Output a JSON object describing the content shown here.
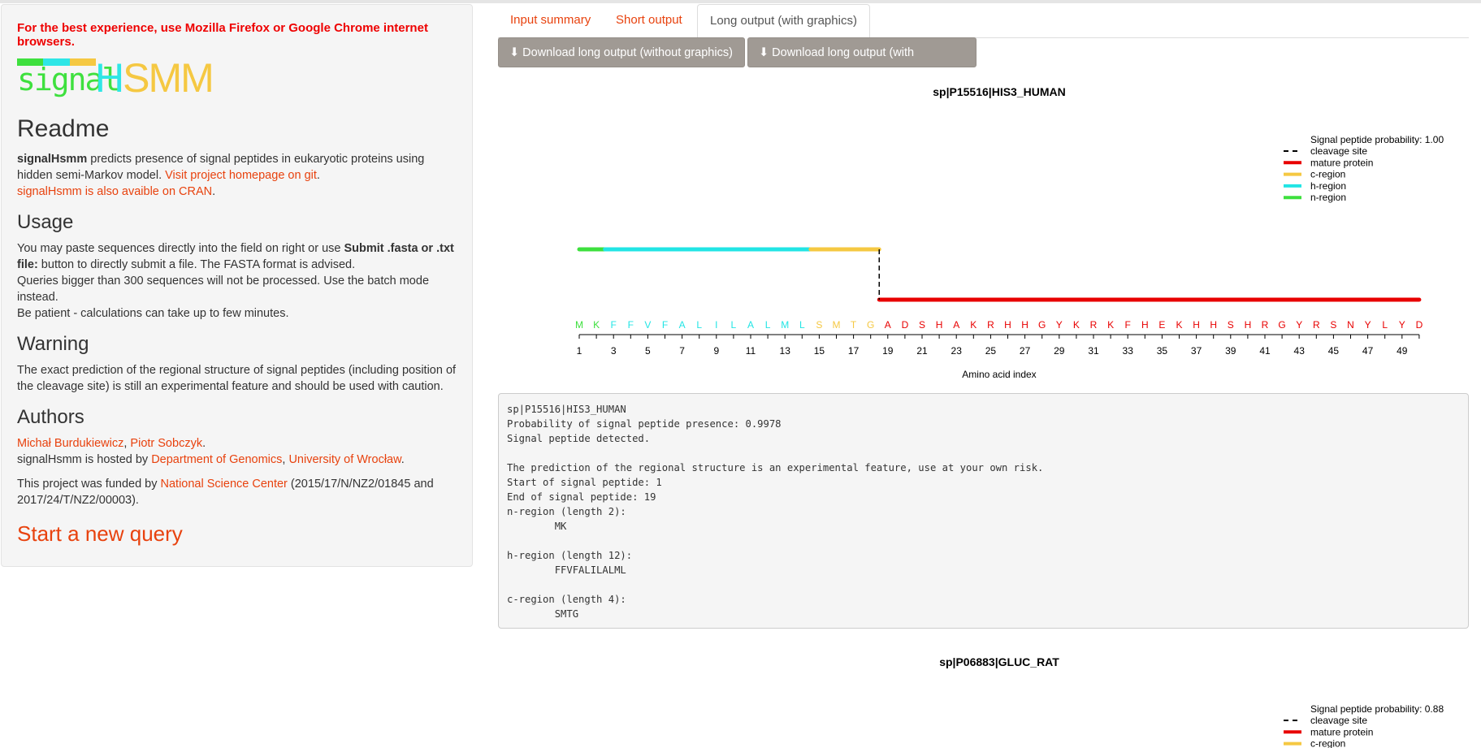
{
  "sidebar": {
    "browser_warning": "For the best experience, use Mozilla Firefox or Google Chrome internet browsers.",
    "logo": {
      "part1": "signal",
      "part2": "HSMM",
      "colors": [
        "#3ee03e",
        "#2ee6e6",
        "#f5c842"
      ]
    },
    "readme": {
      "heading": "Readme",
      "bold": "signalHsmm",
      "text": " predicts presence of signal peptides in eukaryotic proteins using hidden semi-Markov model. ",
      "link_git": "Visit project homepage on git",
      "dot": ".",
      "link_cran": "signalHsmm is also avaible on CRAN",
      "dot2": "."
    },
    "usage": {
      "heading": "Usage",
      "line1_pre": "You may paste sequences directly into the field on right or use ",
      "line1_bold": "Submit .fasta or .txt file:",
      "line1_post": " button to directly submit a file. The FASTA format is advised.",
      "line2": "Queries bigger than 300 sequences will not be processed. Use the batch mode instead.",
      "line3": "Be patient - calculations can take up to few minutes."
    },
    "warning": {
      "heading": "Warning",
      "text": "The exact prediction of the regional structure of signal peptides (including position of the cleavage site) is still an experimental feature and should be used with caution."
    },
    "authors": {
      "heading": "Authors",
      "author1": "Michał Burdukiewicz",
      "sep": ", ",
      "author2": "Piotr Sobczyk",
      "dot": ".",
      "hosted_pre": "signalHsmm is hosted by ",
      "dept": "Department of Genomics",
      "sep2": ", ",
      "univ": "University of Wrocław",
      "dot2": ".",
      "funded_pre": "This project was funded by ",
      "nsc": "National Science Center",
      "funded_post": " (2015/17/N/NZ2/01845 and 2017/24/T/NZ2/00003)."
    },
    "new_query": "Start a new query"
  },
  "tabs": [
    {
      "label": "Input summary"
    },
    {
      "label": "Short output"
    },
    {
      "label": "Long output (with graphics)"
    }
  ],
  "buttons": {
    "download_no_graphics": "⬇ Download long output (without graphics)",
    "download_graphics": "⬇ Download long output (with graphics)"
  },
  "colors": {
    "n_region": "#3ee03e",
    "h_region": "#22e5e5",
    "c_region": "#f5c842",
    "mature": "#e80000",
    "accent": "#e8420e"
  },
  "chart_data": [
    {
      "type": "line",
      "title": "sp|P15516|HIS3_HUMAN",
      "xlabel": "Amino acid index",
      "probability_label": "Signal peptide probability: 1.00",
      "legend": [
        "cleavage site",
        "mature protein",
        "c-region",
        "h-region",
        "n-region"
      ],
      "legend_position": "top-right",
      "sequence": [
        "M",
        "K",
        "F",
        "F",
        "V",
        "F",
        "A",
        "L",
        "I",
        "L",
        "A",
        "L",
        "M",
        "L",
        "S",
        "M",
        "T",
        "G",
        "A",
        "D",
        "S",
        "H",
        "A",
        "K",
        "R",
        "H",
        "H",
        "G",
        "Y",
        "K",
        "R",
        "K",
        "F",
        "H",
        "E",
        "K",
        "H",
        "H",
        "S",
        "H",
        "R",
        "G",
        "Y",
        "R",
        "S",
        "N",
        "Y",
        "L",
        "Y",
        "D"
      ],
      "regions": [
        {
          "name": "n-region",
          "start": 1,
          "end": 2
        },
        {
          "name": "h-region",
          "start": 3,
          "end": 14
        },
        {
          "name": "c-region",
          "start": 15,
          "end": 18
        },
        {
          "name": "mature protein",
          "start": 19,
          "end": 50
        }
      ],
      "cleavage_site": 19,
      "x_ticks": [
        1,
        3,
        5,
        7,
        9,
        11,
        13,
        15,
        17,
        19,
        21,
        23,
        25,
        27,
        29,
        31,
        33,
        35,
        37,
        39,
        41,
        43,
        45,
        47,
        49
      ],
      "xlim": [
        1,
        50
      ]
    },
    {
      "type": "line",
      "title": "sp|P06883|GLUC_RAT",
      "probability_label": "Signal peptide probability: 0.88",
      "legend": [
        "cleavage site",
        "mature protein",
        "c-region"
      ],
      "legend_position": "top-right"
    }
  ],
  "long_output": {
    "lines": [
      "sp|P15516|HIS3_HUMAN",
      "Probability of signal peptide presence: 0.9978",
      "Signal peptide detected.",
      "",
      "The prediction of the regional structure is an experimental feature, use at your own risk.",
      "Start of signal peptide: 1",
      "End of signal peptide: 19",
      "n-region (length 2):",
      "        MK",
      "",
      "h-region (length 12):",
      "        FFVFALILALML",
      "",
      "c-region (length 4):",
      "        SMTG"
    ]
  }
}
